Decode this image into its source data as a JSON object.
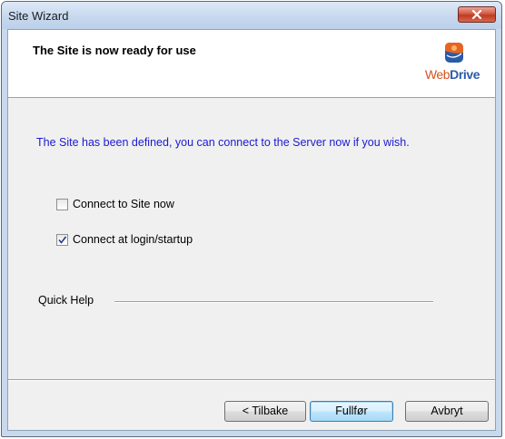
{
  "window": {
    "title": "Site Wizard",
    "close_icon": "close-icon"
  },
  "header": {
    "title": "The Site is now ready for use",
    "logo": {
      "brand_web": "Web",
      "brand_drive": "Drive"
    }
  },
  "body": {
    "info_text": "The Site has been defined, you can connect to the Server now if you wish.",
    "options": [
      {
        "label": "Connect to Site now",
        "checked": false
      },
      {
        "label": "Connect at login/startup",
        "checked": true
      }
    ],
    "quick_help_label": "Quick Help"
  },
  "buttons": {
    "back": "< Tilbake",
    "finish": "Fullfør",
    "cancel": "Avbryt"
  },
  "colors": {
    "info_text": "#1a1ad0",
    "logo_orange": "#d3531f",
    "logo_blue": "#2a5ba8",
    "close_button": "#c23a22"
  }
}
